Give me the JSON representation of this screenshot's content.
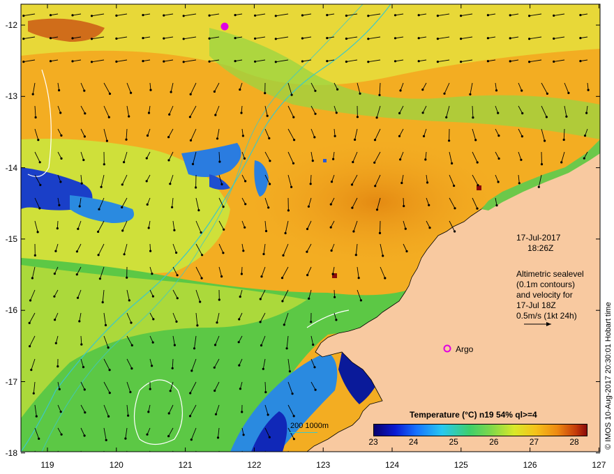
{
  "map": {
    "date": "17-Jul-2017",
    "time": "18:26Z",
    "info_lines": [
      "Altimetric sealevel",
      "(0.1m contours)",
      "and velocity for",
      "17-Jul 18Z",
      "0.5m/s (1kt 24h)"
    ],
    "argo_label": "Argo",
    "credit": "© IMOS 10-Aug-2017 20:30:01 Hobart time",
    "bathy_scale_label": "200  1000m"
  },
  "axes": {
    "x_ticks": [
      "119",
      "120",
      "121",
      "122",
      "123",
      "124",
      "125",
      "126",
      "127"
    ],
    "y_ticks": [
      "-12",
      "-13",
      "-14",
      "-15",
      "-16",
      "-17",
      "-18"
    ]
  },
  "colorbar": {
    "title": "Temperature (°C) n19 54% ql>=4",
    "ticks": [
      "23",
      "24",
      "25",
      "26",
      "27",
      "28"
    ]
  },
  "colors": {
    "land": "#f8c9a0",
    "warm_sst": "#f0a020",
    "mid_sst": "#c8de30",
    "cool_sst": "#2a6adb",
    "bathymetry_contour": "#3cc8c8",
    "argo_marker": "#e000e0"
  },
  "icons": {
    "argo_marker": "circle-marker-icon",
    "velocity_arrow": "arrow-icon"
  }
}
